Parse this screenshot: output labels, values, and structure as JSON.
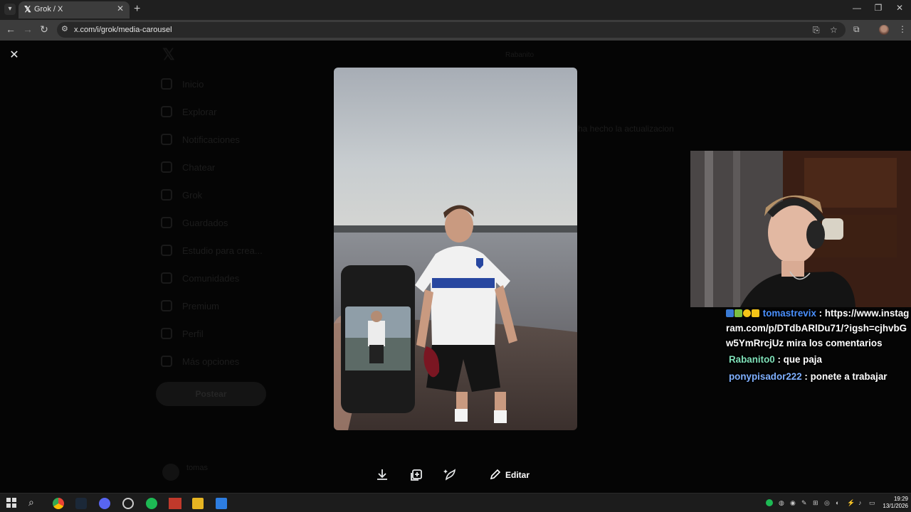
{
  "browser": {
    "tab_title": "Grok / X",
    "tab_favicon": "𝕏",
    "url": "x.com/i/grok/media-carousel"
  },
  "background_page": {
    "sidebar": [
      {
        "label": "Inicio",
        "icon": "home-icon"
      },
      {
        "label": "Explorar",
        "icon": "search-icon"
      },
      {
        "label": "Notificaciones",
        "icon": "bell-icon"
      },
      {
        "label": "Chatear",
        "icon": "mail-icon"
      },
      {
        "label": "Grok",
        "icon": "grok-icon"
      },
      {
        "label": "Guardados",
        "icon": "bookmark-icon"
      },
      {
        "label": "Estudio para crea...",
        "icon": "studio-icon"
      },
      {
        "label": "Comunidades",
        "icon": "people-icon"
      },
      {
        "label": "Premium",
        "icon": "x-icon"
      },
      {
        "label": "Perfil",
        "icon": "person-icon"
      },
      {
        "label": "Más opciones",
        "icon": "more-icon"
      }
    ],
    "post_button": "Postear",
    "user_name": "tomas",
    "grok_header": "Rabanito",
    "grok_input": "ha hecho la actualizacion"
  },
  "carousel": {
    "edit_label": "Editar",
    "actions": [
      "download-icon",
      "add-media-icon",
      "grok-imagine-icon",
      "pencil-icon"
    ]
  },
  "chat": {
    "messages": [
      {
        "user": "tomastrevix",
        "text": "https://www.instagram.com/p/DTdbARlDu71/?igsh=cjhvbGw5YmRrcjUz mira los comentarios"
      },
      {
        "user": "Rabanito0",
        "text": "que paja"
      },
      {
        "user": "ponypisador222",
        "text": "ponete a trabajar"
      }
    ]
  },
  "taskbar": {
    "time": "19:29",
    "date": "13/1/2026"
  },
  "colors": {
    "chat_user_1": "#4a90ff",
    "chat_user_2": "#7fe0b8",
    "chat_user_3": "#7fb0ff",
    "browser_frame": "#1f1f1f"
  }
}
